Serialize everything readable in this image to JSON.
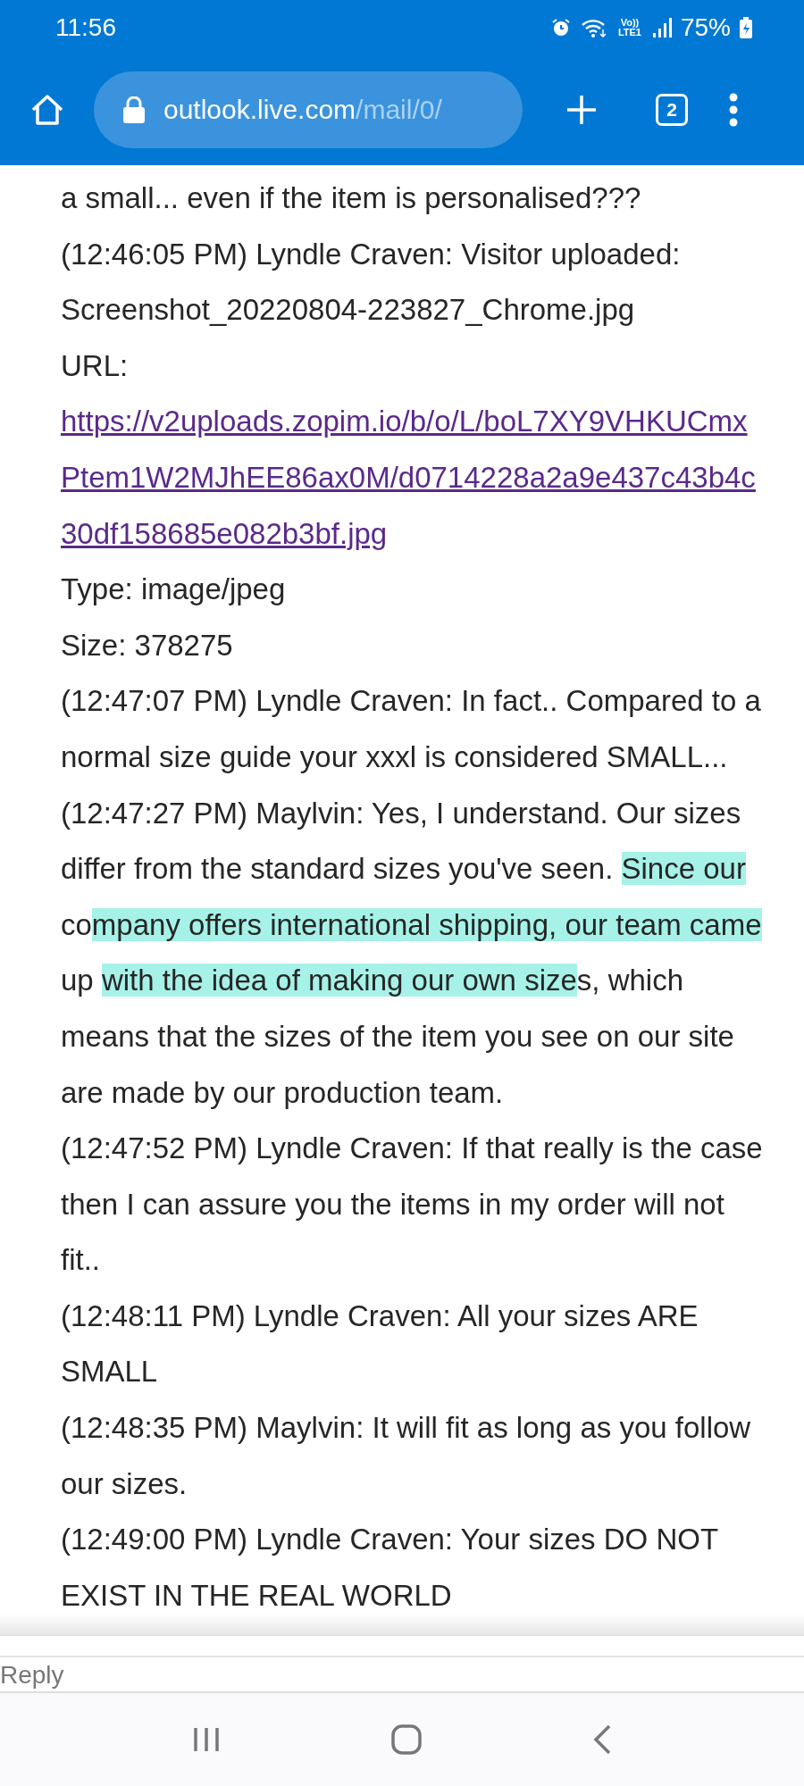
{
  "status_bar": {
    "time": "11:56",
    "network": "Vo)) LTE1",
    "battery": "75%"
  },
  "browser": {
    "url_host": "outlook.live.com",
    "url_path": "/mail/0/",
    "tab_count": "2"
  },
  "message_lines": [
    {
      "kind": "text",
      "segments": [
        {
          "text": "a small... even if the item is personalised???",
          "highlighted": false
        }
      ]
    },
    {
      "kind": "text",
      "segments": [
        {
          "text": "(12:46:05 PM) Lyndle Craven: Visitor uploaded:",
          "highlighted": false
        }
      ]
    },
    {
      "kind": "text",
      "segments": [
        {
          "text": "Screenshot_20220804-223827_Chrome.jpg",
          "highlighted": false
        }
      ]
    },
    {
      "kind": "text",
      "segments": [
        {
          "text": "URL:",
          "highlighted": false
        }
      ]
    },
    {
      "kind": "link",
      "segments": [
        {
          "text": "https://v2uploads.zopim.io/b/o/L/boL7XY9VHKUCmx",
          "highlighted": false
        }
      ]
    },
    {
      "kind": "link",
      "segments": [
        {
          "text": "Ptem1W2MJhEE86ax0M/d0714228a2a9e437c43b4c",
          "highlighted": false
        }
      ]
    },
    {
      "kind": "link",
      "segments": [
        {
          "text": "30df158685e082b3bf.jpg",
          "highlighted": false
        }
      ]
    },
    {
      "kind": "text",
      "segments": [
        {
          "text": "Type: image/jpeg",
          "highlighted": false
        }
      ]
    },
    {
      "kind": "text",
      "segments": [
        {
          "text": "Size: 378275",
          "highlighted": false
        }
      ]
    },
    {
      "kind": "text",
      "segments": [
        {
          "text": "(12:47:07 PM) Lyndle Craven: In fact.. Compared to a",
          "highlighted": false
        }
      ]
    },
    {
      "kind": "text",
      "segments": [
        {
          "text": "normal size guide your xxxl is considered SMALL...",
          "highlighted": false
        }
      ]
    },
    {
      "kind": "text",
      "segments": [
        {
          "text": "(12:47:27 PM) Maylvin: Yes, I understand. Our sizes",
          "highlighted": false
        }
      ]
    },
    {
      "kind": "text",
      "segments": [
        {
          "text": "differ from the standard sizes you've seen. ",
          "highlighted": false
        },
        {
          "text": "Since our",
          "highlighted": true
        }
      ]
    },
    {
      "kind": "text",
      "segments": [
        {
          "text": "co",
          "highlighted": false
        },
        {
          "text": "mpany offers international shipping, our team came",
          "highlighted": true
        }
      ]
    },
    {
      "kind": "text",
      "segments": [
        {
          "text": "up ",
          "highlighted": false
        },
        {
          "text": "with the idea of making our own size",
          "highlighted": true
        },
        {
          "text": "s, which",
          "highlighted": false
        }
      ]
    },
    {
      "kind": "text",
      "segments": [
        {
          "text": "means that the sizes of the item you see on our site",
          "highlighted": false
        }
      ]
    },
    {
      "kind": "text",
      "segments": [
        {
          "text": "are made by our production team.",
          "highlighted": false
        }
      ]
    },
    {
      "kind": "text",
      "segments": [
        {
          "text": "(12:47:52 PM) Lyndle Craven: If that really is the case",
          "highlighted": false
        }
      ]
    },
    {
      "kind": "text",
      "segments": [
        {
          "text": "then I can assure you the items in my order will not",
          "highlighted": false
        }
      ]
    },
    {
      "kind": "text",
      "segments": [
        {
          "text": "fit..",
          "highlighted": false
        }
      ]
    },
    {
      "kind": "text",
      "segments": [
        {
          "text": "(12:48:11 PM) Lyndle Craven: All your sizes ARE",
          "highlighted": false
        }
      ]
    },
    {
      "kind": "text",
      "segments": [
        {
          "text": "SMALL",
          "highlighted": false
        }
      ]
    },
    {
      "kind": "text",
      "segments": [
        {
          "text": "(12:48:35 PM) Maylvin: It will fit as long as you follow",
          "highlighted": false
        }
      ]
    },
    {
      "kind": "text",
      "segments": [
        {
          "text": "our sizes.",
          "highlighted": false
        }
      ]
    },
    {
      "kind": "text",
      "segments": [
        {
          "text": "(12:49:00 PM) Lyndle Craven: Your sizes DO NOT",
          "highlighted": false
        }
      ]
    },
    {
      "kind": "text",
      "segments": [
        {
          "text": "EXIST IN THE REAL WORLD",
          "highlighted": false
        }
      ]
    }
  ],
  "reply": {
    "label": "Reply"
  }
}
